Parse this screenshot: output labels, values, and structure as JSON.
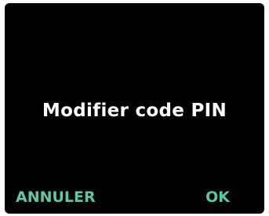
{
  "screen": {
    "title": "Modifier code PIN",
    "cancel_label": "ANNULER",
    "ok_label": "OK"
  },
  "colors": {
    "background": "#000000",
    "title": "#ffffff",
    "accent": "#5cc8aa"
  }
}
